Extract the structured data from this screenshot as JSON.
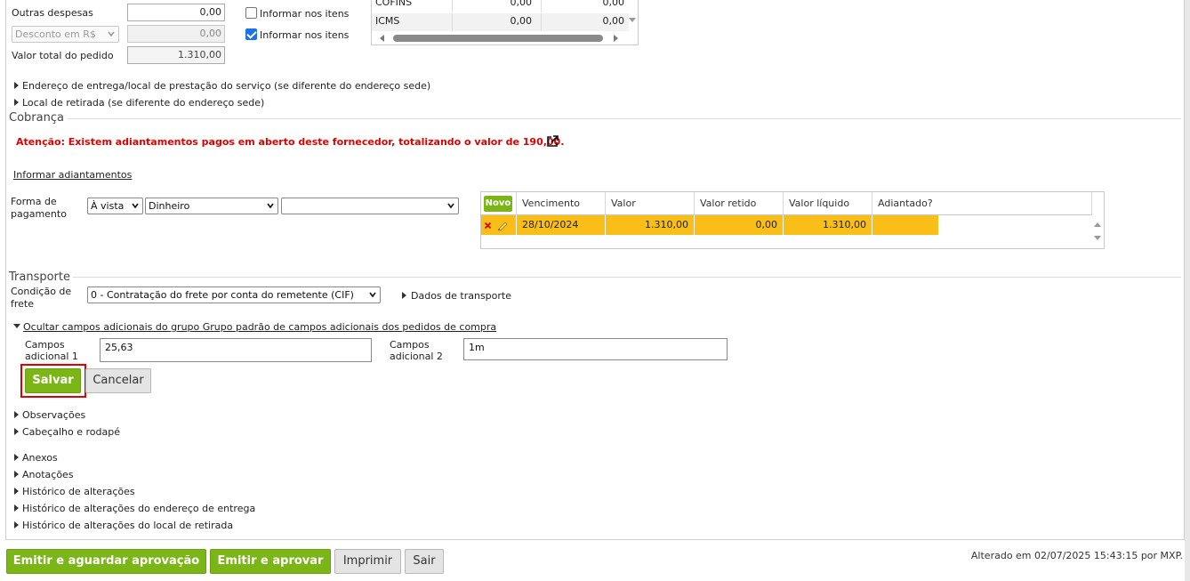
{
  "totals": {
    "outras_despesas_label": "Outras despesas",
    "outras_despesas_value": "0,00",
    "desconto_select": "Desconto em R$",
    "desconto_value": "0,00",
    "valor_total_label": "Valor total do pedido",
    "valor_total_value": "1.310,00",
    "informar_itens_1": "Informar nos itens",
    "informar_itens_2": "Informar nos itens"
  },
  "tax_table": {
    "rows": [
      {
        "name": "COFINS",
        "v1": "0,00",
        "v2": "0,00"
      },
      {
        "name": "ICMS",
        "v1": "0,00",
        "v2": "0,00"
      }
    ]
  },
  "expanders_top": {
    "endereco_entrega": "Endereço de entrega/local de prestação do serviço (se diferente do endereço sede)",
    "local_retirada": "Local de retirada (se diferente do endereço sede)"
  },
  "cobranca": {
    "title": "Cobrança",
    "alert": "Atenção: Existem adiantamentos pagos em aberto deste fornecedor, totalizando o valor de 190,00.",
    "informar_link": "Informar adiantamentos",
    "forma_label_1": "Forma de",
    "forma_label_2": "pagamento",
    "select_prazo": "À vista",
    "select_meio": "Dinheiro",
    "select_extra": ""
  },
  "grid": {
    "novo_label": "Novo",
    "headers": [
      "Vencimento",
      "Valor",
      "Valor retido",
      "Valor líquido",
      "Adiantado?"
    ],
    "rows": [
      {
        "vencimento": "28/10/2024",
        "valor": "1.310,00",
        "retido": "0,00",
        "liquido": "1.310,00",
        "adiantado": ""
      }
    ]
  },
  "transporte": {
    "title": "Transporte",
    "cond_label_1": "Condição de",
    "cond_label_2": "frete",
    "cond_select": "0 - Contratação do frete por conta do remetente (CIF)",
    "dados_link": "Dados de transporte"
  },
  "campos": {
    "ocultar_link": "Ocultar campos adicionais do grupo Grupo padrão de campos adicionais dos pedidos de compra",
    "c1_label_1": "Campos",
    "c1_label_2": "adicional 1",
    "c1_value": "25,63",
    "c2_label_1": "Campos",
    "c2_label_2": "adicional 2",
    "c2_value": "1m",
    "salvar": "Salvar",
    "cancelar": "Cancelar"
  },
  "expanders_bottom": {
    "observacoes": "Observações",
    "cabecalho": "Cabeçalho e rodapé",
    "anexos": "Anexos",
    "anotacoes": "Anotações",
    "historico": "Histórico de alterações",
    "historico_entrega": "Histórico de alterações do endereço de entrega",
    "historico_retirada": "Histórico de alterações do local de retirada"
  },
  "footer": {
    "emitir_aguardar": "Emitir e aguardar aprovação",
    "emitir_aprovar": "Emitir e aprovar",
    "imprimir": "Imprimir",
    "sair": "Sair",
    "status": "Alterado em 02/07/2025 15:43:15 por MXP."
  },
  "colors": {
    "accent_green": "#7cb518",
    "row_highlight": "#f9be17",
    "alert_red": "#e00000"
  }
}
